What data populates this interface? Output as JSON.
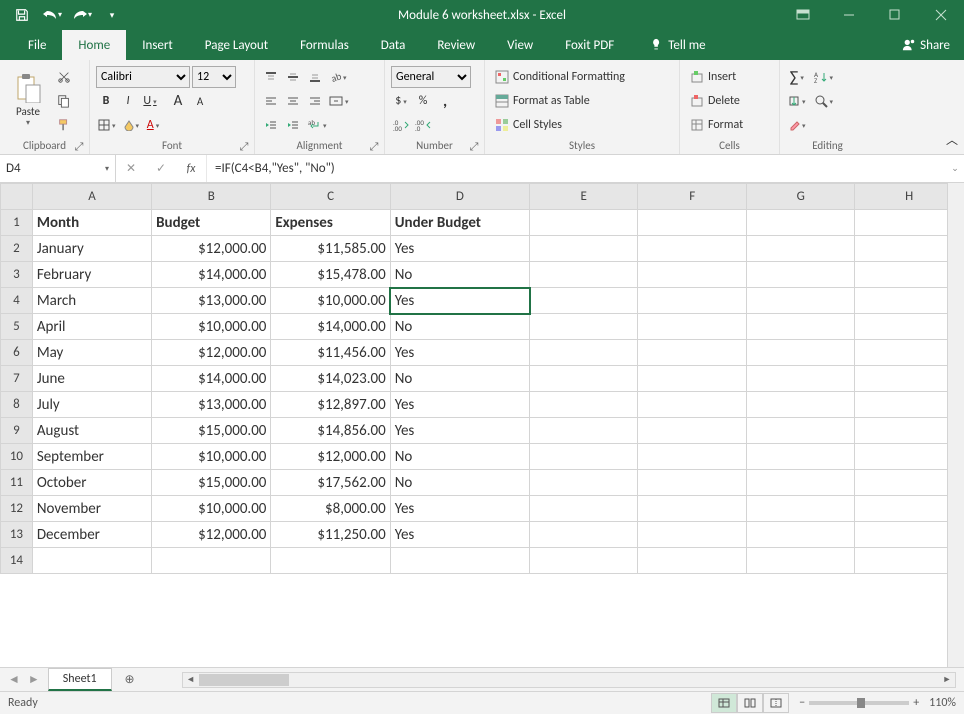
{
  "app": {
    "title": "Module 6 worksheet.xlsx - Excel"
  },
  "tabs": {
    "file": "File",
    "home": "Home",
    "insert": "Insert",
    "pagelayout": "Page Layout",
    "formulas": "Formulas",
    "data": "Data",
    "review": "Review",
    "view": "View",
    "foxit": "Foxit PDF",
    "tellme": "Tell me",
    "share": "Share"
  },
  "ribbon": {
    "clipboard": {
      "label": "Clipboard",
      "paste": "Paste"
    },
    "font": {
      "label": "Font",
      "name": "Calibri",
      "size": "12",
      "bold": "B",
      "italic": "I",
      "underline": "U",
      "grow": "A",
      "shrink": "A"
    },
    "alignment": {
      "label": "Alignment"
    },
    "number": {
      "label": "Number",
      "format": "General",
      "currency": "$",
      "percent": "%",
      "comma": ","
    },
    "styles": {
      "label": "Styles",
      "condfmt": "Conditional Formatting",
      "fmttable": "Format as Table",
      "cellstyles": "Cell Styles"
    },
    "cells": {
      "label": "Cells",
      "insert": "Insert",
      "delete": "Delete",
      "format": "Format"
    },
    "editing": {
      "label": "Editing"
    }
  },
  "namebox": "D4",
  "formula": "=IF(C4<B4,\"Yes\", \"No\")",
  "columns": [
    "A",
    "B",
    "C",
    "D",
    "E",
    "F",
    "G",
    "H"
  ],
  "headers": {
    "a": "Month",
    "b": "Budget",
    "c": "Expenses",
    "d": "Under Budget"
  },
  "rows": [
    {
      "n": 2,
      "month": "January",
      "budget": "$12,000.00",
      "expenses": "$11,585.00",
      "under": "Yes"
    },
    {
      "n": 3,
      "month": "February",
      "budget": "$14,000.00",
      "expenses": "$15,478.00",
      "under": "No"
    },
    {
      "n": 4,
      "month": "March",
      "budget": "$13,000.00",
      "expenses": "$10,000.00",
      "under": "Yes"
    },
    {
      "n": 5,
      "month": "April",
      "budget": "$10,000.00",
      "expenses": "$14,000.00",
      "under": "No"
    },
    {
      "n": 6,
      "month": "May",
      "budget": "$12,000.00",
      "expenses": "$11,456.00",
      "under": "Yes"
    },
    {
      "n": 7,
      "month": "June",
      "budget": "$14,000.00",
      "expenses": "$14,023.00",
      "under": "No"
    },
    {
      "n": 8,
      "month": "July",
      "budget": "$13,000.00",
      "expenses": "$12,897.00",
      "under": "Yes"
    },
    {
      "n": 9,
      "month": "August",
      "budget": "$15,000.00",
      "expenses": "$14,856.00",
      "under": "Yes"
    },
    {
      "n": 10,
      "month": "September",
      "budget": "$10,000.00",
      "expenses": "$12,000.00",
      "under": "No"
    },
    {
      "n": 11,
      "month": "October",
      "budget": "$15,000.00",
      "expenses": "$17,562.00",
      "under": "No"
    },
    {
      "n": 12,
      "month": "November",
      "budget": "$10,000.00",
      "expenses": "$8,000.00",
      "under": "Yes"
    },
    {
      "n": 13,
      "month": "December",
      "budget": "$12,000.00",
      "expenses": "$11,250.00",
      "under": "Yes"
    }
  ],
  "sheets": {
    "active": "Sheet1"
  },
  "status": {
    "ready": "Ready",
    "zoom": "110%"
  }
}
